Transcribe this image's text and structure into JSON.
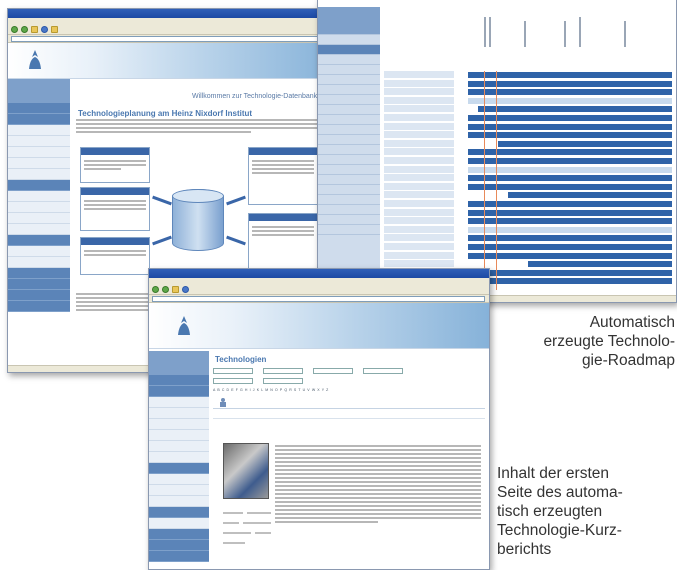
{
  "captions": {
    "roadmap": [
      "Automatisch",
      "erzeugte Technolo-",
      "gie-Roadmap"
    ],
    "report": [
      "Inhalt der ersten",
      "Seite des automa-",
      "tisch erzeugten",
      "Technologie-Kurz-",
      "berichts"
    ]
  },
  "welcome_window": {
    "page_heading": "Willkommen zur Technologie-Datenbank",
    "section_title": "Technologieplanung am Heinz Nixdorf Institut",
    "diagram_labels": [
      "Informationsbereitstellung (Bereitstellung / Visualisierung)",
      "Technologie-Datenbank",
      "Technologie-Roadmap"
    ]
  },
  "tech_window": {
    "section_title": "Technologien"
  },
  "colors": {
    "nav_blue": "#5b84b8",
    "bar_blue": "#2f63a8",
    "timeline_orange": "#e88a5a",
    "title_blue": "#4a78b0"
  }
}
